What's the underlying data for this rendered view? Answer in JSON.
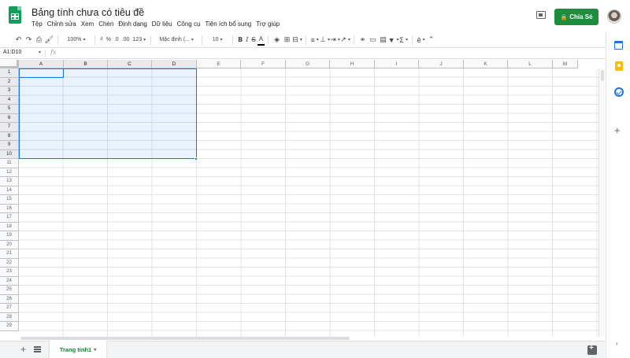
{
  "header": {
    "doc_title": "Bảng tính chưa có tiêu đề",
    "star_icon": "☆",
    "share_label": "Chia Sẻ",
    "lock_icon": "🔒"
  },
  "menu": [
    "Tệp",
    "Chỉnh sửa",
    "Xem",
    "Chèn",
    "Định dạng",
    "Dữ liệu",
    "Công cụ",
    "Tiện ích bổ sung",
    "Trợ giúp"
  ],
  "toolbar": {
    "undo_icon": "↶",
    "redo_icon": "↷",
    "print_icon": "⎙",
    "paint_icon": "🖌",
    "zoom": "100%",
    "currency": "₫",
    "percent": "%",
    "dec_less": ".0",
    "dec_more": ".00",
    "number_format": "123",
    "font": "Mặc định (...",
    "font_size": "10",
    "bold": "B",
    "italic": "I",
    "strike": "S",
    "text_color": "A",
    "fill_icon": "◈",
    "borders_icon": "⊞",
    "merge_icon": "⊟",
    "halign_icon": "≡",
    "valign_icon": "⊥",
    "wrap_icon": "⇥",
    "rotate_icon": "↗",
    "link_icon": "⚭",
    "comment_icon": "▭",
    "chart_icon": "▤",
    "filter_icon": "▼",
    "function_icon": "Σ",
    "input_tools_icon": "ê",
    "more_icon": "⌃"
  },
  "formula_bar": {
    "name_box": "A1:D10",
    "fx": "fx"
  },
  "grid": {
    "columns": [
      "A",
      "B",
      "C",
      "D",
      "E",
      "F",
      "G",
      "H",
      "I",
      "J",
      "K",
      "L",
      "M"
    ],
    "rows": [
      "1",
      "2",
      "3",
      "4",
      "5",
      "6",
      "7",
      "8",
      "9",
      "10",
      "11",
      "12",
      "13",
      "14",
      "15",
      "16",
      "17",
      "18",
      "19",
      "20",
      "21",
      "22",
      "23",
      "24",
      "25",
      "26",
      "27",
      "28",
      "29"
    ],
    "selected_range": "A1:D10"
  },
  "sheets": {
    "add_icon": "+",
    "tabs": [
      "Trang tính1"
    ]
  },
  "side_panel": {
    "addons_icon": "+",
    "expand_icon": "›"
  },
  "colors": {
    "accent": "#1a73e8",
    "share_button": "#1e8e3e",
    "sheets_green": "#0f9d58"
  }
}
